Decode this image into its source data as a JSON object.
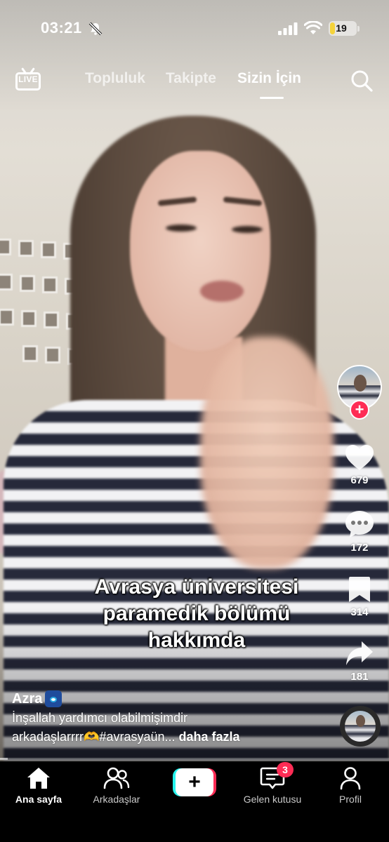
{
  "status_bar": {
    "time": "03:21",
    "battery_level": "19",
    "battery_fraction": 0.19,
    "silent_mode_icon": "bell-slash-icon",
    "signal_icon": "cellular-signal-icon",
    "wifi_icon": "wifi-icon"
  },
  "top_nav": {
    "live_label": "LIVE",
    "tabs": [
      {
        "label": "Topluluk",
        "active": false
      },
      {
        "label": "Takipte",
        "active": false
      },
      {
        "label": "Sizin İçin",
        "active": true
      }
    ],
    "search_icon": "search-icon"
  },
  "video": {
    "caption": [
      "Avrasya üniversitesi",
      "paramedik bölümü",
      "hakkımda"
    ],
    "progress_fraction": 0.02
  },
  "actions": {
    "likes": "679",
    "comments": "172",
    "saves": "314",
    "shares": "181",
    "follow_symbol": "+"
  },
  "post": {
    "username": "Azra",
    "username_emoji": "hamsa-emoji",
    "description_line1": "İnşallah yardımcı olabilmişimdir",
    "description_line2": "arkadaşlarrrr🫶#avrasyaün...",
    "more_label": "daha fazla"
  },
  "tabbar": {
    "items": [
      {
        "label": "Ana sayfa",
        "icon": "home-icon",
        "active": true
      },
      {
        "label": "Arkadaşlar",
        "icon": "friends-icon",
        "active": false
      },
      {
        "label": "",
        "icon": "create-plus-icon",
        "active": false
      },
      {
        "label": "Gelen kutusu",
        "icon": "inbox-icon",
        "active": false
      },
      {
        "label": "Profil",
        "icon": "profile-icon",
        "active": false
      }
    ],
    "create_symbol": "+",
    "inbox_badge": "3"
  },
  "colors": {
    "accent_red": "#fe2c55",
    "accent_cyan": "#25f4ee",
    "battery_yellow": "#f5d33b"
  }
}
